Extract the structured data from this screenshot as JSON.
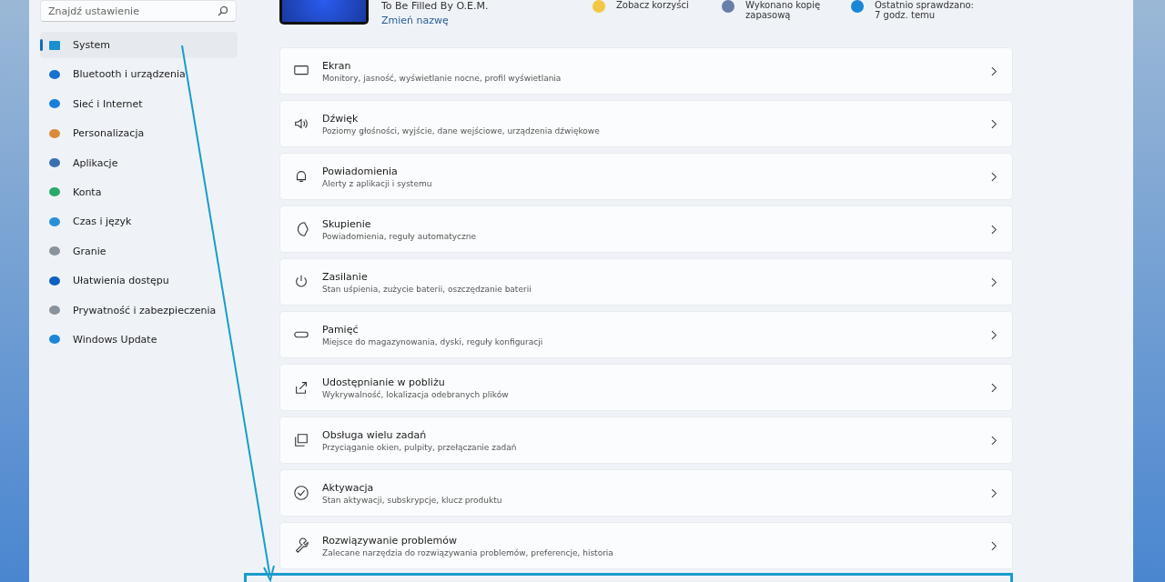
{
  "search": {
    "placeholder": "Znajdź ustawienie"
  },
  "sidebar": {
    "items": [
      {
        "label": "System",
        "selected": true
      },
      {
        "label": "Bluetooth i urządzenia",
        "selected": false
      },
      {
        "label": "Sieć i Internet",
        "selected": false
      },
      {
        "label": "Personalizacja",
        "selected": false
      },
      {
        "label": "Aplikacje",
        "selected": false
      },
      {
        "label": "Konta",
        "selected": false
      },
      {
        "label": "Czas i język",
        "selected": false
      },
      {
        "label": "Granie",
        "selected": false
      },
      {
        "label": "Ułatwienia dostępu",
        "selected": false
      },
      {
        "label": "Prywatność i zabezpieczenia",
        "selected": false
      },
      {
        "label": "Windows Update",
        "selected": false
      }
    ]
  },
  "device": {
    "name": "To Be Filled By O.E.M.",
    "rename_link": "Zmień nazwę"
  },
  "status_tiles": [
    {
      "text": "Zobacz korzyści"
    },
    {
      "text": "Wykonano kopię zapasową"
    },
    {
      "text": "Ostatnio sprawdzano: 7 godz. temu"
    }
  ],
  "settings": [
    {
      "title": "Ekran",
      "subtitle": "Monitory, jasność, wyświetlanie nocne, profil wyświetlania"
    },
    {
      "title": "Dźwięk",
      "subtitle": "Poziomy głośności, wyjście, dane wejściowe, urządzenia dźwiękowe"
    },
    {
      "title": "Powiadomienia",
      "subtitle": "Alerty z aplikacji i systemu"
    },
    {
      "title": "Skupienie",
      "subtitle": "Powiadomienia, reguły automatyczne"
    },
    {
      "title": "Zasilanie",
      "subtitle": "Stan uśpienia, zużycie baterii, oszczędzanie baterii"
    },
    {
      "title": "Pamięć",
      "subtitle": "Miejsce do magazynowania, dyski, reguły konfiguracji"
    },
    {
      "title": "Udostępnianie w pobliżu",
      "subtitle": "Wykrywalność, lokalizacja odebranych plików"
    },
    {
      "title": "Obsługa wielu zadań",
      "subtitle": "Przyciąganie okien, pulpity, przełączanie zadań"
    },
    {
      "title": "Aktywacja",
      "subtitle": "Stan aktywacji, subskrypcje, klucz produktu"
    },
    {
      "title": "Rozwiązywanie problemów",
      "subtitle": "Zalecane narzędzia do rozwiązywania problemów, preferencje, historia"
    }
  ]
}
